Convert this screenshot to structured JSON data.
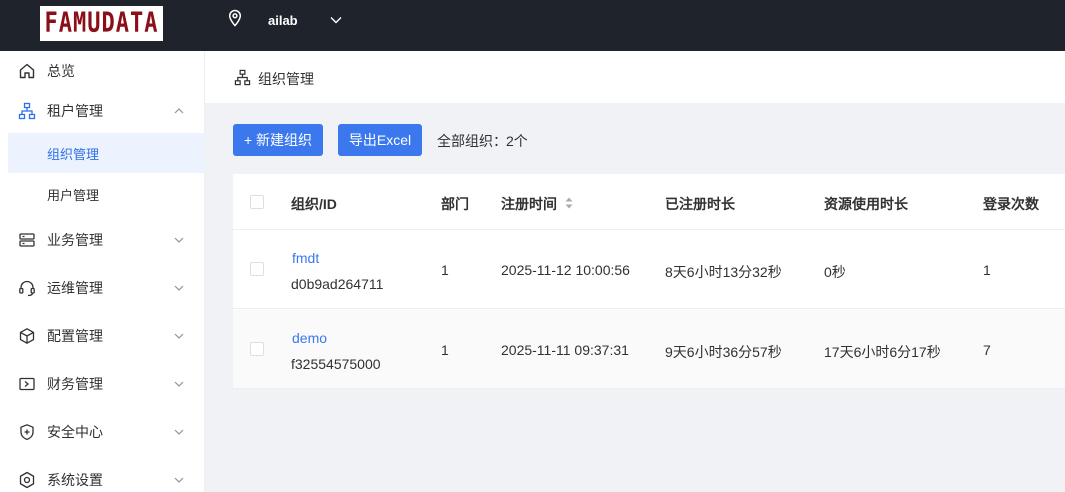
{
  "topbar": {
    "logo_text": "FAMUDATA",
    "tenant": "ailab"
  },
  "sidebar": {
    "items": [
      {
        "label": "总览"
      },
      {
        "label": "租户管理"
      },
      {
        "label": "组织管理"
      },
      {
        "label": "用户管理"
      },
      {
        "label": "业务管理"
      },
      {
        "label": "运维管理"
      },
      {
        "label": "配置管理"
      },
      {
        "label": "财务管理"
      },
      {
        "label": "安全中心"
      },
      {
        "label": "系统设置"
      }
    ]
  },
  "breadcrumb": {
    "label": "组织管理"
  },
  "toolbar": {
    "new_label": "+ 新建组织",
    "export_label": "导出Excel",
    "count_label": "全部组织：",
    "count_value": "2个"
  },
  "table": {
    "columns": [
      "组织/ID",
      "部门",
      "注册时间",
      "已注册时长",
      "资源使用时长",
      "登录次数"
    ],
    "rows": [
      {
        "name": "fmdt",
        "id": "d0b9ad264711",
        "dept": "1",
        "registered": "2025-11-12 10:00:56",
        "duration": "8天6小时13分32秒",
        "usage": "0秒",
        "logins": "1"
      },
      {
        "name": "demo",
        "id": "f32554575000",
        "dept": "1",
        "registered": "2025-11-11 09:37:31",
        "duration": "9天6小时36分57秒",
        "usage": "17天6小时6分17秒",
        "logins": "7"
      }
    ]
  },
  "colors": {
    "accent": "#3b78ee",
    "topbar": "#1f232b",
    "brand": "#8b0f19"
  }
}
